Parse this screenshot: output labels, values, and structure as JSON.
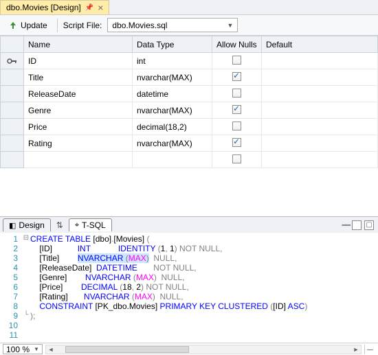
{
  "tab": {
    "title": "dbo.Movies [Design]"
  },
  "toolbar": {
    "update": "Update",
    "script_label": "Script File:",
    "script_file": "dbo.Movies.sql"
  },
  "grid": {
    "headers": {
      "name": "Name",
      "type": "Data Type",
      "nulls": "Allow Nulls",
      "default": "Default"
    },
    "rows": [
      {
        "key": true,
        "name": "ID",
        "type": "int",
        "nulls": false
      },
      {
        "key": false,
        "name": "Title",
        "type": "nvarchar(MAX)",
        "nulls": true
      },
      {
        "key": false,
        "name": "ReleaseDate",
        "type": "datetime",
        "nulls": false
      },
      {
        "key": false,
        "name": "Genre",
        "type": "nvarchar(MAX)",
        "nulls": true
      },
      {
        "key": false,
        "name": "Price",
        "type": "decimal(18,2)",
        "nulls": false
      },
      {
        "key": false,
        "name": "Rating",
        "type": "nvarchar(MAX)",
        "nulls": true
      }
    ]
  },
  "bottom": {
    "design": "Design",
    "tsql": "T-SQL"
  },
  "code": {
    "l1a": "CREATE",
    "l1b": " TABLE",
    "l1c": " [dbo]",
    "l1d": ".",
    "l1e": "[Movies]",
    "l1f": " (",
    "l2a": "    [ID]           ",
    "l2b": "INT",
    "l2c": "            ",
    "l2d": "IDENTITY",
    "l2e": " (",
    "l2f": "1",
    "l2g": ", ",
    "l2h": "1",
    "l2i": ") ",
    "l2j": "NOT",
    "l2k": " NULL,",
    "l3a": "    [Title]        ",
    "l3b": "NVARCHAR",
    "l3c": " (",
    "l3d": "MAX",
    "l3e": ")",
    "l3f": "  ",
    "l3g": "NULL,",
    "l4a": "    [ReleaseDate]  ",
    "l4b": "DATETIME",
    "l4c": "       ",
    "l4d": "NOT",
    "l4e": " NULL,",
    "l5a": "    [Genre]        ",
    "l5b": "NVARCHAR",
    "l5c": " (",
    "l5d": "MAX",
    "l5e": ")  ",
    "l5f": "NULL,",
    "l6a": "    [Price]        ",
    "l6b": "DECIMAL",
    "l6c": " (",
    "l6d": "18",
    "l6e": ", ",
    "l6f": "2",
    "l6g": ") ",
    "l6h": "NOT",
    "l6i": " NULL,",
    "l7a": "    [Rating]       ",
    "l7b": "NVARCHAR",
    "l7c": " (",
    "l7d": "MAX",
    "l7e": ")  ",
    "l7f": "NULL,",
    "l8a": "    ",
    "l8b": "CONSTRAINT",
    "l8c": " [PK_dbo.Movies] ",
    "l8d": "PRIMARY",
    "l8e": " KEY",
    "l8f": " CLUSTERED",
    "l8g": " (",
    "l8h": "[ID]",
    "l8i": " ASC",
    "l8j": ")",
    "l9a": ");"
  },
  "status": {
    "zoom": "100 %"
  }
}
